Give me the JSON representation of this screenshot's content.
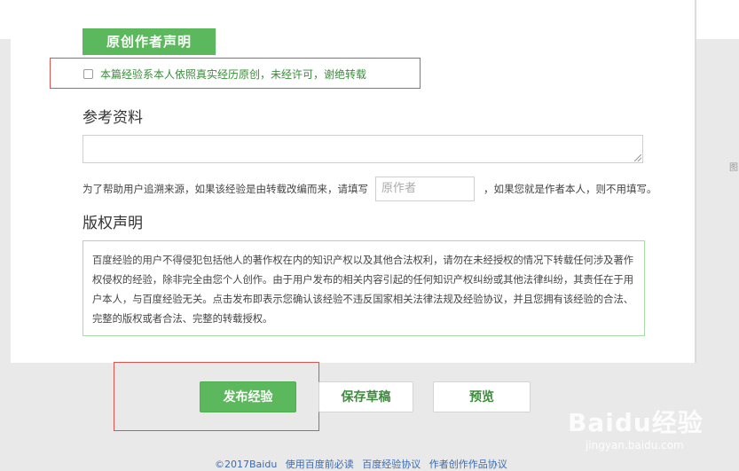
{
  "original_statement": {
    "title": "原创作者声明",
    "declaration_checked": false,
    "declaration_text": "本篇经验系本人依照真实经历原创，未经许可，谢绝转载"
  },
  "references": {
    "title": "参考资料",
    "textarea_value": ""
  },
  "source_author": {
    "prefix_text": "为了帮助用户追溯来源，如果该经验是由转载改编而来，请填写",
    "input_placeholder": "原作者",
    "suffix_text": "，如果您就是作者本人，则不用填写。"
  },
  "copyright": {
    "title": "版权声明",
    "text": "百度经验的用户不得侵犯包括他人的著作权在内的知识产权以及其他合法权利，请勿在未经授权的情况下转载任何涉及著作权侵权的经验，除非完全由您个人创作。由于用户发布的相关内容引起的任何知识产权纠纷或其他法律纠纷，其责任在于用户本人，与百度经验无关。点击发布即表示您确认该经验不违反国家相关法律法规及经验协议，并且您拥有该经验的合法、完整的版权或者合法、完整的转载授权。"
  },
  "actions": {
    "publish_label": "发布经验",
    "save_draft_label": "保存草稿",
    "preview_label": "预览"
  },
  "footer": {
    "links": [
      "©2017Baidu",
      "使用百度前必读",
      "百度经验协议",
      "作者创作作品协议"
    ]
  },
  "watermark": {
    "logo_text": "Baidu经验",
    "url_text": "jingyan.baidu.com"
  },
  "colors": {
    "accent_green": "#5cb85c",
    "highlight_red": "#d9534f"
  }
}
